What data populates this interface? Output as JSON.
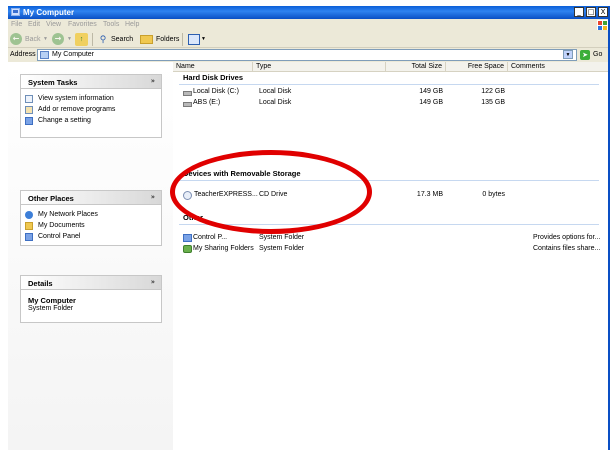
{
  "window": {
    "title": "My Computer",
    "buttons": [
      "_",
      "□",
      "X"
    ]
  },
  "menu": [
    "File",
    "Edit",
    "View",
    "Favorites",
    "Tools",
    "Help"
  ],
  "toolbar": {
    "back_label": "Back",
    "search_label": "Search",
    "folders_label": "Folders"
  },
  "address": {
    "label": "Address",
    "value": "My Computer",
    "go_label": "Go"
  },
  "sidebar": {
    "system_tasks": {
      "title": "System Tasks",
      "items": [
        {
          "label": "View system information",
          "icon": "info-icon"
        },
        {
          "label": "Add or remove programs",
          "icon": "add-remove-programs-icon"
        },
        {
          "label": "Change a setting",
          "icon": "control-panel-icon"
        }
      ]
    },
    "other_places": {
      "title": "Other Places",
      "items": [
        {
          "label": "My Network Places",
          "icon": "network-places-icon"
        },
        {
          "label": "My Documents",
          "icon": "documents-folder-icon"
        },
        {
          "label": "Control Panel",
          "icon": "control-panel-icon"
        }
      ]
    },
    "details": {
      "title": "Details",
      "name": "My Computer",
      "type": "System Folder"
    }
  },
  "list": {
    "columns": [
      "Name",
      "Type",
      "Total Size",
      "Free Space",
      "Comments"
    ],
    "groups": {
      "hard_disk": {
        "title": "Hard Disk Drives",
        "rows": [
          {
            "name": "Local Disk (C:)",
            "type": "Local Disk",
            "total": "149 GB",
            "free": "122 GB",
            "comments": ""
          },
          {
            "name": "ABS (E:)",
            "type": "Local Disk",
            "total": "149 GB",
            "free": "135 GB",
            "comments": ""
          }
        ]
      },
      "removable": {
        "title": "Devices with Removable Storage",
        "rows": [
          {
            "name": "TeacherEXPRESS...",
            "type": "CD Drive",
            "total": "17.3 MB",
            "free": "0 bytes",
            "comments": ""
          }
        ]
      },
      "other": {
        "title": "Other",
        "rows": [
          {
            "name": "Control P...",
            "type": "System Folder",
            "total": "",
            "free": "",
            "comments": "Provides options for..."
          },
          {
            "name": "My Sharing Folders",
            "type": "System Folder",
            "total": "",
            "free": "",
            "comments": "Contains files share..."
          }
        ]
      }
    }
  },
  "colors": {
    "titlebar": "#0a5fd8",
    "annotation_ring": "#e00000",
    "group_header_line": "#c6d8f0"
  }
}
